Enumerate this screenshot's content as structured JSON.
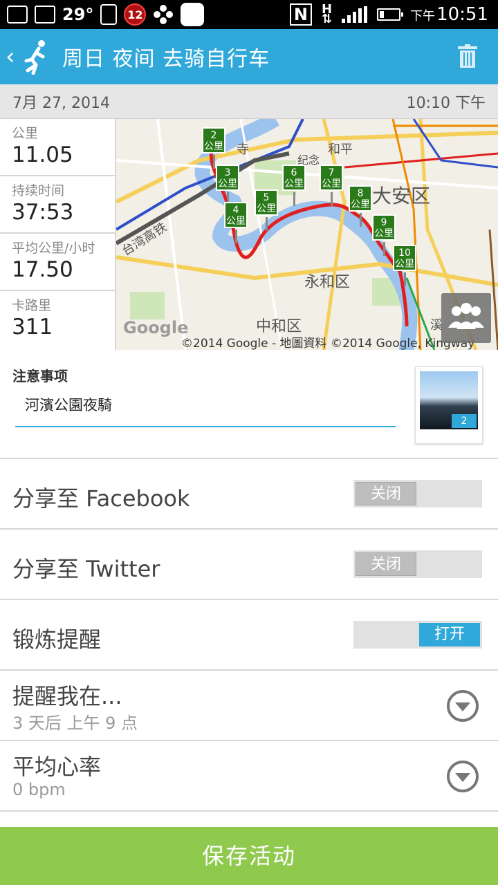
{
  "status_bar": {
    "temperature": "29°",
    "badge_count": "12",
    "time_prefix": "下午",
    "time": "10:51",
    "icons": [
      "leaf-icon",
      "power-icon",
      "discount-tag-icon",
      "pinwheel-icon",
      "app-icon",
      "nfc-icon",
      "network-icon",
      "signal-icon",
      "battery-icon"
    ]
  },
  "app_bar": {
    "title": "周日 夜间 去骑自行车",
    "back_icon": "chevron-left-icon",
    "activity_icon": "runner-icon",
    "delete_icon": "trash-icon"
  },
  "date_bar": {
    "date": "7月 27, 2014",
    "time": "10:10 下午"
  },
  "stats": [
    {
      "label": "公里",
      "value": "11.05"
    },
    {
      "label": "持续时间",
      "value": "37:53"
    },
    {
      "label": "平均公里/小时",
      "value": "17.50"
    },
    {
      "label": "卡路里",
      "value": "311"
    }
  ],
  "map": {
    "labels": {
      "daan": "大安区",
      "yonghe": "永和区",
      "zhonghe": "中和区",
      "rail": "台湾高铁",
      "park": "和平",
      "memorial": "纪念",
      "temple": "寺",
      "xi": "溪"
    },
    "google": "Google",
    "copyright": "©2014 Google - 地圖資料 ©2014 Google, Kingway",
    "marker_unit": "公里",
    "markers": [
      "2",
      "3",
      "4",
      "5",
      "6",
      "7",
      "8",
      "9",
      "10"
    ],
    "route_color": "#e02020",
    "share_button_icon": "people-icon"
  },
  "notes": {
    "heading": "注意事项",
    "value": "河濱公園夜騎",
    "photo_count": "2"
  },
  "settings": {
    "facebook": {
      "label": "分享至 Facebook",
      "state": "关闭"
    },
    "twitter": {
      "label": "分享至 Twitter",
      "state": "关闭"
    },
    "reminder": {
      "label": "锻炼提醒",
      "state": "打开"
    },
    "remind_at": {
      "label": "提醒我在...",
      "sub": "3 天后 上午 9 点"
    },
    "heart_rate": {
      "label": "平均心率",
      "sub": "0 bpm"
    }
  },
  "save_button": "保存活动",
  "colors": {
    "accent": "#30a8da",
    "save": "#8fc94d",
    "marker": "#2a7a1a"
  }
}
